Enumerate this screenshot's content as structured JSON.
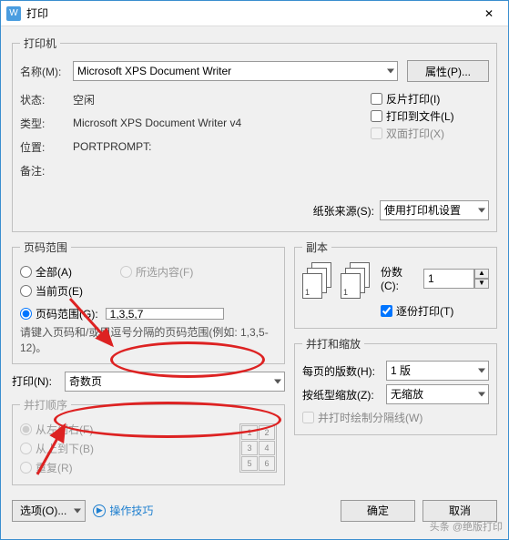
{
  "window": {
    "title": "打印",
    "close": "✕",
    "app_icon": "W"
  },
  "printer": {
    "legend": "打印机",
    "name_label": "名称(M):",
    "name_value": "Microsoft XPS Document Writer",
    "properties_btn": "属性(P)...",
    "status_label": "状态:",
    "status_value": "空闲",
    "type_label": "类型:",
    "type_value": "Microsoft XPS Document Writer v4",
    "where_label": "位置:",
    "where_value": "PORTPROMPT:",
    "comment_label": "备注:",
    "comment_value": "",
    "reverse": "反片打印(I)",
    "print_to_file": "打印到文件(L)",
    "duplex": "双面打印(X)"
  },
  "paper_source": {
    "label": "纸张来源(S):",
    "value": "使用打印机设置"
  },
  "range": {
    "legend": "页码范围",
    "all": "全部(A)",
    "current": "当前页(E)",
    "selection": "所选内容(F)",
    "pages": "页码范围(G):",
    "pages_value": "1,3,5,7",
    "hint": "请键入页码和/或用逗号分隔的页码范围(例如: 1,3,5-12)。"
  },
  "print_what": {
    "label": "打印(N):",
    "value": "奇数页"
  },
  "copies": {
    "legend": "副本",
    "count_label": "份数(C):",
    "count_value": "1",
    "collate": "逐份打印(T)"
  },
  "zoom": {
    "legend": "并打和缩放",
    "per_sheet_label": "每页的版数(H):",
    "per_sheet_value": "1 版",
    "scale_label": "按纸型缩放(Z):",
    "scale_value": "无缩放",
    "draw_lines": "并打时绘制分隔线(W)"
  },
  "order": {
    "legend": "并打顺序",
    "lr": "从左到右(F)",
    "tb": "从上到下(B)",
    "repeat": "重复(R)"
  },
  "footer": {
    "options": "选项(O)...",
    "tips": "操作技巧",
    "ok": "确定",
    "cancel": "取消"
  },
  "watermark": "头条 @绝版打印",
  "order_cells": [
    "1",
    "2",
    "3",
    "4",
    "5",
    "6"
  ]
}
